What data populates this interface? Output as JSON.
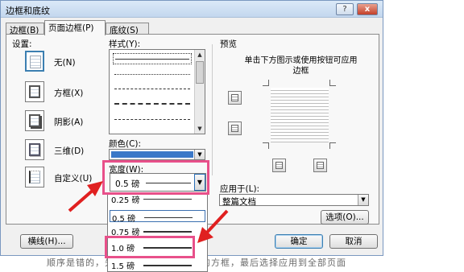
{
  "window": {
    "title": "边框和底纹",
    "help_label": "?",
    "close_label": "x"
  },
  "tabs": [
    {
      "label": "边框(B)"
    },
    {
      "label": "页面边框(P)"
    },
    {
      "label": "底纹(S)"
    }
  ],
  "settings": {
    "label": "设置:",
    "items": [
      {
        "label": "无(N)",
        "icon": "none-border-icon"
      },
      {
        "label": "方框(X)",
        "icon": "box-border-icon"
      },
      {
        "label": "阴影(A)",
        "icon": "shadow-border-icon"
      },
      {
        "label": "三维(D)",
        "icon": "3d-border-icon"
      },
      {
        "label": "自定义(U)",
        "icon": "custom-border-icon"
      }
    ],
    "active_index": 0
  },
  "style": {
    "label": "样式(Y):"
  },
  "color": {
    "label": "颜色(C):",
    "value": "#3a78c8"
  },
  "width": {
    "label": "宽度(W):",
    "value": "0.5 磅"
  },
  "width_options": [
    "0.25 磅",
    "0.5 磅",
    "0.75 磅",
    "1.0 磅",
    "1.5 磅"
  ],
  "preview": {
    "label": "预览",
    "hint": "单击下方图示或使用按钮可应用边框"
  },
  "apply_to": {
    "label": "应用于(L):",
    "value": "整篇文档"
  },
  "buttons": {
    "options": "选项(O)...",
    "horizontal_line": "横线(H)...",
    "ok": "确定",
    "cancel": "取消"
  },
  "background_text": "顺序是错的，先设置宽度再点击左侧的方框，最后选择应用到全部页面"
}
